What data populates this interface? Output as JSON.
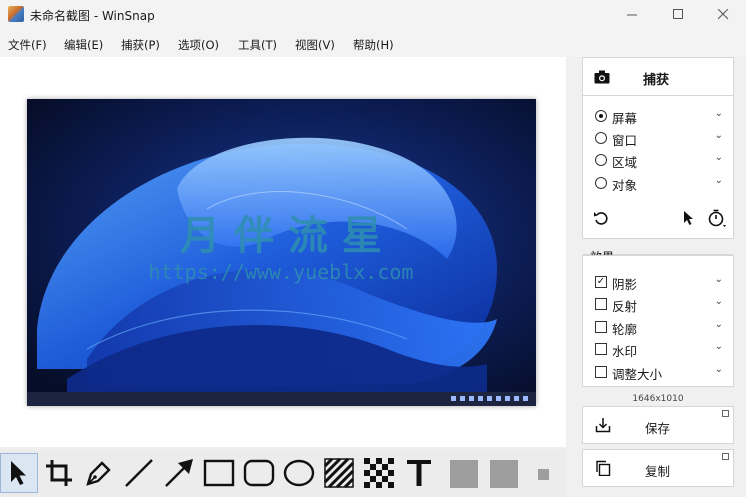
{
  "window": {
    "title": "未命名截图 - WinSnap",
    "minimize_icon": "minimize-icon",
    "maximize_icon": "maximize-icon",
    "close_icon": "close-icon"
  },
  "menu": [
    "文件(F)",
    "编辑(E)",
    "捕获(P)",
    "选项(O)",
    "工具(T)",
    "视图(V)",
    "帮助(H)"
  ],
  "screenshot": {
    "watermark_title": "月 伴 流 星",
    "watermark_url": "https://www.yueblx.com"
  },
  "capture": {
    "label": "捕获",
    "modes": [
      {
        "label": "屏幕",
        "selected": true
      },
      {
        "label": "窗口",
        "selected": false
      },
      {
        "label": "区域",
        "selected": false
      },
      {
        "label": "对象",
        "selected": false
      }
    ]
  },
  "effects": {
    "label": "效果",
    "items": [
      {
        "label": "阴影",
        "checked": true
      },
      {
        "label": "反射",
        "checked": false
      },
      {
        "label": "轮廓",
        "checked": false
      },
      {
        "label": "水印",
        "checked": false
      },
      {
        "label": "调整大小",
        "checked": false
      }
    ]
  },
  "image_size": "1646x1010",
  "actions": {
    "save": "保存",
    "copy": "复制"
  },
  "colors": {
    "checkmark": "#111111",
    "watermark": "#2e8fb0",
    "accent": "#0078d4"
  }
}
